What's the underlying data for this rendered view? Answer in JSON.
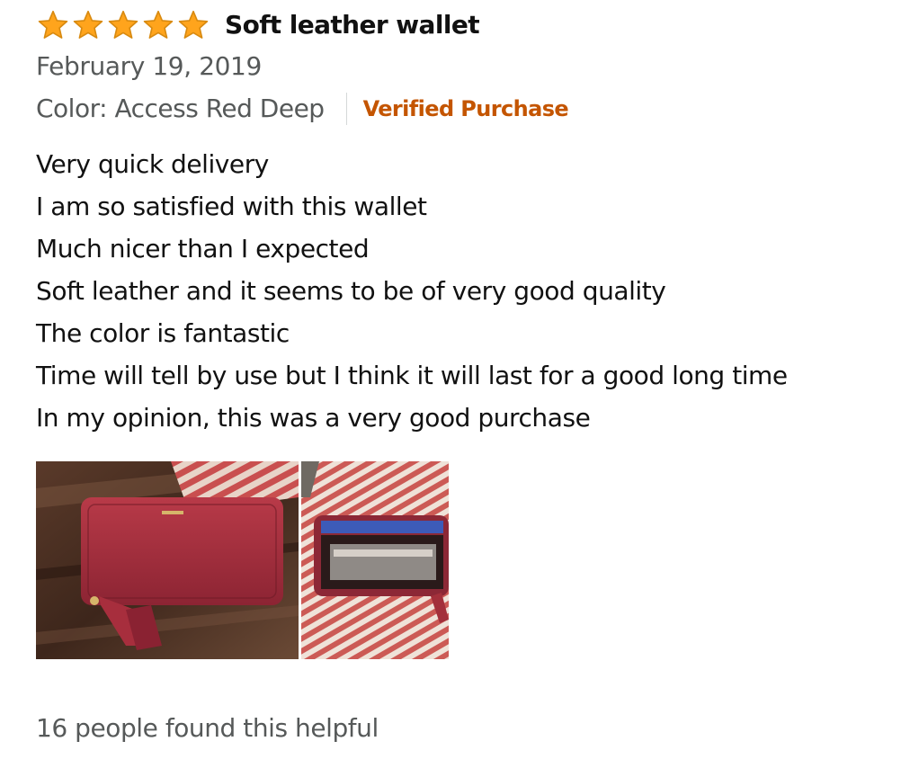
{
  "review": {
    "rating": 5,
    "rating_max": 5,
    "star_color": "#ffa41c",
    "title": "Soft leather wallet",
    "date": "February 19, 2019",
    "color_variant": "Color: Access Red Deep",
    "verified_label": "Verified Purchase",
    "verified_color": "#c45500",
    "body_lines": [
      "Very quick delivery",
      "I am so satisfied with this wallet",
      "Much nicer than I expected",
      "Soft leather and it seems to be of very good quality",
      "The color is fantastic",
      "Time will tell by use but I think it will last for a good long time",
      "In my opinion, this was a very good purchase"
    ],
    "images": [
      {
        "icon": "wallet-photo-closed"
      },
      {
        "icon": "wallet-photo-open"
      }
    ],
    "helpful_text": "16 people found this helpful"
  }
}
